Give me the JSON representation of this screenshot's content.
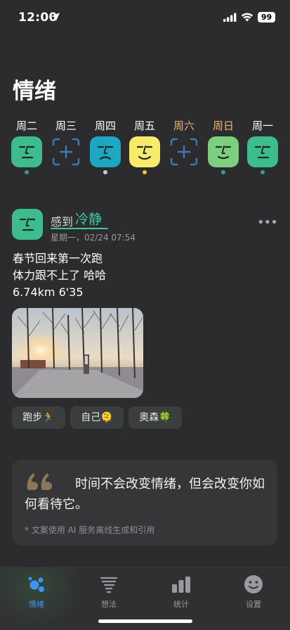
{
  "status_bar": {
    "time": "12:00",
    "battery": "99"
  },
  "page": {
    "title": "情绪"
  },
  "week": [
    {
      "label": "周二",
      "weekend": false,
      "mood": "face",
      "color": "#3dbd8e",
      "dot_color": "#2aa57d"
    },
    {
      "label": "周三",
      "weekend": false,
      "mood": "empty",
      "color": "#3f78b8",
      "dot_color": ""
    },
    {
      "label": "周四",
      "weekend": false,
      "mood": "face",
      "color": "#1ea7c2",
      "dot_color": "#aecdf0"
    },
    {
      "label": "周五",
      "weekend": false,
      "mood": "face",
      "color": "#f9ea6c",
      "dot_color": "#f2c12e"
    },
    {
      "label": "周六",
      "weekend": true,
      "mood": "empty",
      "color": "#3f78b8",
      "dot_color": ""
    },
    {
      "label": "周日",
      "weekend": true,
      "mood": "face",
      "color": "#7ccf7f",
      "dot_color": "#2aa57d"
    },
    {
      "label": "周一",
      "weekend": false,
      "mood": "face",
      "color": "#3dbd8e",
      "dot_color": "#2aa57d"
    }
  ],
  "entry": {
    "feel_prefix": "感到",
    "feel_word": "冷静",
    "date": "星期一，02/24 07:54",
    "more_label": "•••",
    "lines": [
      "春节回来第一次跑",
      "体力跟不上了 哈哈",
      "6.74km 6'35"
    ],
    "tags": [
      "跑步🏃",
      "自己🫠",
      "奥森🍀"
    ],
    "accent": "#3dc9a0"
  },
  "quote": {
    "text": "时间不会改变情绪，但会改变你如何看待它。",
    "note": "* 文案使用 AI 服务离线生成和引用"
  },
  "tabs": [
    {
      "label": "情绪",
      "icon": "bubbles-icon",
      "active": true
    },
    {
      "label": "想法",
      "icon": "tornado-icon",
      "active": false
    },
    {
      "label": "统计",
      "icon": "bar-chart-icon",
      "active": false
    },
    {
      "label": "设置",
      "icon": "smiley-icon",
      "active": false
    }
  ]
}
